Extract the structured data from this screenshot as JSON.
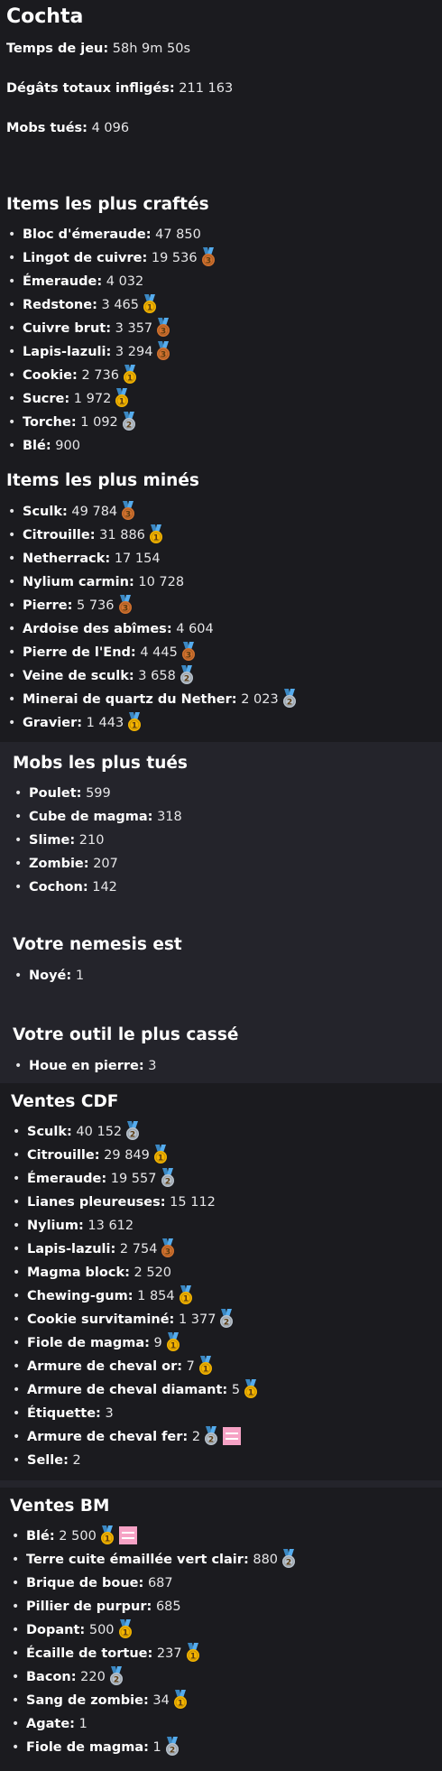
{
  "player": "Cochta",
  "stats": [
    {
      "label": "Temps de jeu",
      "value": "58h 9m 50s"
    },
    {
      "label": "Dégâts totaux infligés",
      "value": "211 163"
    },
    {
      "label": "Mobs tués",
      "value": "4 096"
    }
  ],
  "sections": [
    {
      "title": "Items les plus craftés",
      "items": [
        {
          "name": "Bloc d'émeraude",
          "value": "47 850",
          "medal": null
        },
        {
          "name": "Lingot de cuivre",
          "value": "19 536",
          "medal": "3"
        },
        {
          "name": "Émeraude",
          "value": "4 032",
          "medal": null
        },
        {
          "name": "Redstone",
          "value": "3 465",
          "medal": "1"
        },
        {
          "name": "Cuivre brut",
          "value": "3 357",
          "medal": "3"
        },
        {
          "name": "Lapis-lazuli",
          "value": "3 294",
          "medal": "3"
        },
        {
          "name": "Cookie",
          "value": "2 736",
          "medal": "1"
        },
        {
          "name": "Sucre",
          "value": "1 972",
          "medal": "1"
        },
        {
          "name": "Torche",
          "value": "1 092",
          "medal": "2"
        },
        {
          "name": "Blé",
          "value": "900",
          "medal": null
        }
      ]
    },
    {
      "title": "Items les plus minés",
      "items": [
        {
          "name": "Sculk",
          "value": "49 784",
          "medal": "3"
        },
        {
          "name": "Citrouille",
          "value": "31 886",
          "medal": "1"
        },
        {
          "name": "Netherrack",
          "value": "17 154",
          "medal": null
        },
        {
          "name": "Nylium carmin",
          "value": "10 728",
          "medal": null
        },
        {
          "name": "Pierre",
          "value": "5 736",
          "medal": "3"
        },
        {
          "name": "Ardoise des abîmes",
          "value": "4 604",
          "medal": null
        },
        {
          "name": "Pierre de l'End",
          "value": "4 445",
          "medal": "3"
        },
        {
          "name": "Veine de sculk",
          "value": "3 658",
          "medal": "2"
        },
        {
          "name": "Minerai de quartz du Nether",
          "value": "2 023",
          "medal": "2"
        },
        {
          "name": "Gravier",
          "value": "1 443",
          "medal": "1"
        }
      ]
    },
    {
      "title": "Mobs les plus tués",
      "items": [
        {
          "name": "Poulet",
          "value": "599",
          "medal": null
        },
        {
          "name": "Cube de magma",
          "value": "318",
          "medal": null
        },
        {
          "name": "Slime",
          "value": "210",
          "medal": null
        },
        {
          "name": "Zombie",
          "value": "207",
          "medal": null
        },
        {
          "name": "Cochon",
          "value": "142",
          "medal": null
        }
      ]
    },
    {
      "title": "Votre nemesis est",
      "items": [
        {
          "name": "Noyé",
          "value": "1",
          "medal": null
        }
      ]
    },
    {
      "title": "Votre outil le plus cassé",
      "items": [
        {
          "name": "Houe en pierre",
          "value": "3",
          "medal": null
        }
      ]
    },
    {
      "title": "Ventes CDF",
      "items": [
        {
          "name": "Sculk",
          "value": "40 152",
          "medal": "2"
        },
        {
          "name": "Citrouille",
          "value": "29 849",
          "medal": "1"
        },
        {
          "name": "Émeraude",
          "value": "19 557",
          "medal": "2"
        },
        {
          "name": "Lianes pleureuses",
          "value": "15 112",
          "medal": null
        },
        {
          "name": "Nylium",
          "value": "13 612",
          "medal": null
        },
        {
          "name": "Lapis-lazuli",
          "value": "2 754",
          "medal": "3"
        },
        {
          "name": "Magma block",
          "value": "2 520",
          "medal": null
        },
        {
          "name": "Chewing-gum",
          "value": "1 854",
          "medal": "1"
        },
        {
          "name": "Cookie survitaminé",
          "value": "1 377",
          "medal": "2"
        },
        {
          "name": "Fiole de magma",
          "value": "9",
          "medal": "1"
        },
        {
          "name": "Armure de cheval or",
          "value": "7",
          "medal": "1"
        },
        {
          "name": "Armure de cheval diamant",
          "value": "5",
          "medal": "1"
        },
        {
          "name": "Étiquette",
          "value": "3",
          "medal": null
        },
        {
          "name": "Armure de cheval fer",
          "value": "2",
          "medal": "2",
          "extra": "equal-swatch"
        },
        {
          "name": "Selle",
          "value": "2",
          "medal": null
        }
      ]
    },
    {
      "title": "Ventes BM",
      "items": [
        {
          "name": "Blé",
          "value": "2 500",
          "medal": "1",
          "extra": "equal-swatch"
        },
        {
          "name": "Terre cuite émaillée vert clair",
          "value": "880",
          "medal": "2"
        },
        {
          "name": "Brique de boue",
          "value": "687",
          "medal": null
        },
        {
          "name": "Pillier de purpur",
          "value": "685",
          "medal": null
        },
        {
          "name": "Dopant",
          "value": "500",
          "medal": "1"
        },
        {
          "name": "Écaille de tortue",
          "value": "237",
          "medal": "1"
        },
        {
          "name": "Bacon",
          "value": "220",
          "medal": "2"
        },
        {
          "name": "Sang de zombie",
          "value": "34",
          "medal": "1"
        },
        {
          "name": "Agate",
          "value": "1",
          "medal": null
        },
        {
          "name": "Fiole de magma",
          "value": "1",
          "medal": "2"
        }
      ]
    }
  ],
  "colors": {
    "background": "#1b1b1f",
    "panel": "#24242b",
    "medal_1": "#f4b400",
    "medal_2": "#b8c2cc",
    "medal_3": "#d2722e",
    "ribbon": "#3b88c3",
    "swatch": "#f6a2c5"
  }
}
